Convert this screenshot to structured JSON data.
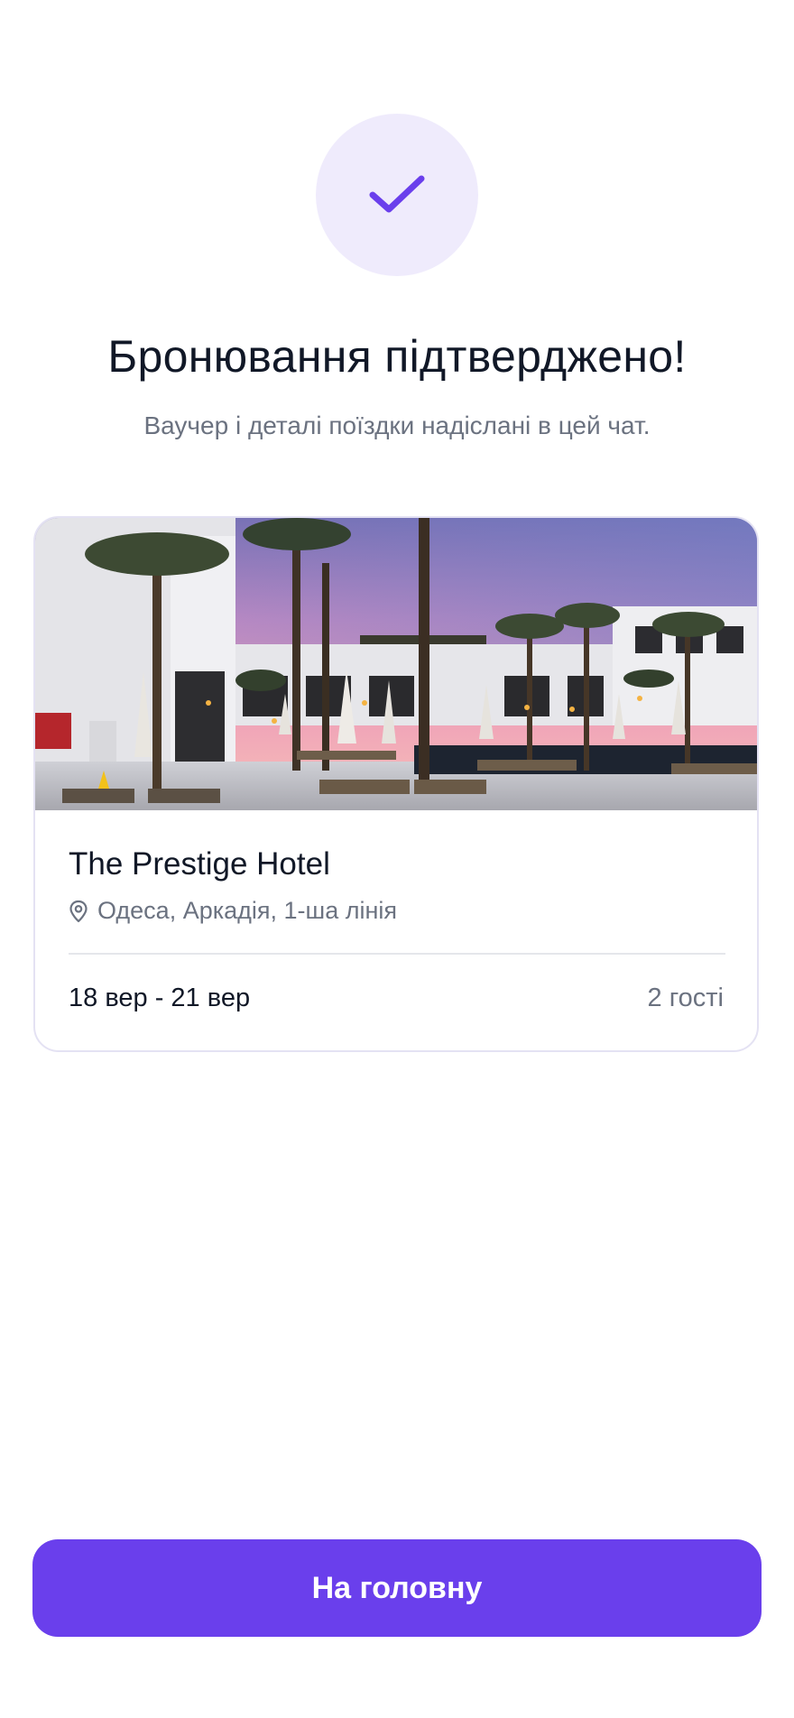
{
  "confirmation": {
    "icon": "check-icon",
    "title": "Бронювання підтверджено!",
    "subtitle": "Ваучер і деталі поїздки надіслані в цей чат."
  },
  "booking": {
    "photo": "hotel-pool-palm-trees-sunset-photo",
    "hotel_name": "The Prestige Hotel",
    "location_icon": "map-pin-icon",
    "location": "Одеса, Аркадія, 1-ша лінія",
    "dates": "18 вер - 21 вер",
    "guests": "2 гості"
  },
  "actions": {
    "home_label": "На головну"
  },
  "colors": {
    "accent": "#6a3fec",
    "accent_light": "#efebfc",
    "text_primary": "#111827",
    "text_secondary": "#6b7280",
    "border": "#e4e2f3"
  }
}
